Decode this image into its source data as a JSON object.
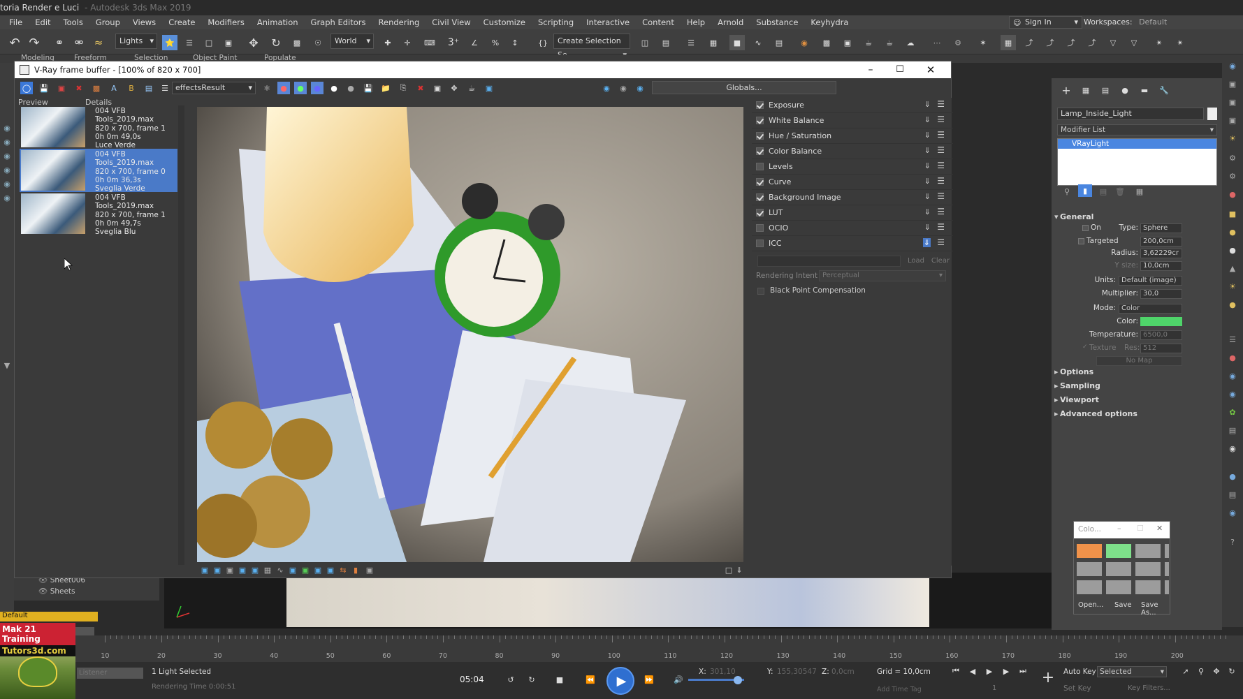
{
  "app": {
    "title": "toria Render e Luci",
    "subtitle": "- Autodesk 3ds Max 2019",
    "sign_in": "Sign In",
    "workspaces_label": "Workspaces:",
    "workspace": "Default"
  },
  "menu": [
    "File",
    "Edit",
    "Tools",
    "Group",
    "Views",
    "Create",
    "Modifiers",
    "Animation",
    "Graph Editors",
    "Rendering",
    "Civil View",
    "Customize",
    "Scripting",
    "Interactive",
    "Content",
    "Help",
    "Arnold",
    "Substance",
    "Keyhydra"
  ],
  "toolbar": {
    "selection_filter": "Lights",
    "coord_system": "World",
    "selection_set": "Create Selection Se"
  },
  "ribbon": [
    "Modeling",
    "Freeform",
    "Selection",
    "Object Paint",
    "Populate"
  ],
  "vfb": {
    "title": "V-Ray frame buffer - [100% of 820 x 700]",
    "channel": "effectsResult",
    "globals": "Globals...",
    "preview_label": "Preview",
    "details_label": "Details",
    "history": [
      {
        "file": "004 VFB Tools_2019.max",
        "res": "820 x 700, frame 1",
        "time": "0h 0m 49,0s",
        "name": "Luce Verde",
        "selected": false
      },
      {
        "file": "004 VFB Tools_2019.max",
        "res": "820 x 700, frame 0",
        "time": "0h 0m 36,3s",
        "name": "Sveglia Verde",
        "selected": true
      },
      {
        "file": "004 VFB Tools_2019.max",
        "res": "820 x 700, frame 1",
        "time": "0h 0m 49,7s",
        "name": "Sveglia Blu",
        "selected": false
      }
    ],
    "layers": [
      {
        "name": "Exposure",
        "on": true
      },
      {
        "name": "White Balance",
        "on": true
      },
      {
        "name": "Hue / Saturation",
        "on": true
      },
      {
        "name": "Color Balance",
        "on": true
      },
      {
        "name": "Levels",
        "on": false
      },
      {
        "name": "Curve",
        "on": true
      },
      {
        "name": "Background Image",
        "on": true
      },
      {
        "name": "LUT",
        "on": true
      },
      {
        "name": "OCIO",
        "on": false
      },
      {
        "name": "ICC",
        "on": false
      }
    ],
    "icc": {
      "load": "Load",
      "clear": "Clear",
      "intent_label": "Rendering Intent",
      "intent_value": "Perceptual",
      "bpc_label": "Black Point Compensation"
    }
  },
  "scene": {
    "sheet_item": "Sheet006",
    "sheets_item": "Sheets",
    "layer_default": "Default"
  },
  "command_panel": {
    "object_name": "Lamp_Inside_Light",
    "modifier_list": "Modifier List",
    "stack_item": "VRayLight",
    "general": "General",
    "on_label": "On",
    "type_label": "Type:",
    "type_value": "Sphere",
    "targeted_label": "Targeted",
    "targeted_value": "200,0cm",
    "radius_label": "Radius:",
    "radius_value": "3,62229cr",
    "ysize_label": "Y size:",
    "ysize_value": "10,0cm",
    "units_label": "Units:",
    "units_value": "Default (image)",
    "multiplier_label": "Multiplier:",
    "multiplier_value": "30,0",
    "mode_label": "Mode:",
    "mode_value": "Color",
    "color_label": "Color:",
    "color_value": "#4fd46a",
    "temp_label": "Temperature:",
    "temp_value": "6500,0",
    "texture_label": "Texture",
    "res_label": "Res:",
    "res_value": "512",
    "nomap": "No Map",
    "sections": [
      "Options",
      "Sampling",
      "Viewport",
      "Advanced options"
    ]
  },
  "color_clipboard": {
    "title": "Colo...",
    "open": "Open...",
    "save": "Save",
    "saveas": "Save As...",
    "swatches": [
      "#f0924a",
      "#7ee08a",
      "#9c9c9c",
      "#9c9c9c",
      "#9c9c9c",
      "#9c9c9c",
      "#9c9c9c",
      "#9c9c9c",
      "#9c9c9c",
      "#9c9c9c",
      "#9c9c9c",
      "#9c9c9c"
    ]
  },
  "timeline": {
    "ticks": [
      "10",
      "20",
      "30",
      "40",
      "50",
      "60",
      "70",
      "80",
      "90",
      "100",
      "110",
      "120",
      "130",
      "140",
      "150",
      "160",
      "170",
      "180",
      "190",
      "200"
    ]
  },
  "status": {
    "selected": "1 Light Selected",
    "render_time": "Rendering Time  0:00:51",
    "listener": "Listener",
    "time": "05:04",
    "x_label": "X:",
    "x_value": "301,10",
    "y_label": "Y:",
    "y_value": "155,30547",
    "z_label": "Z:",
    "z_value": "0,0cm",
    "grid": "Grid = 10,0cm",
    "autokey": "Auto Key",
    "setkey": "Set Key",
    "key_mode": "Selected",
    "key_filters": "Key Filters...",
    "add_time_tag": "Add Time Tag",
    "frame": "1"
  },
  "brand": {
    "line1": "Mak 21 Training",
    "line2": "Tutors3d.com"
  }
}
